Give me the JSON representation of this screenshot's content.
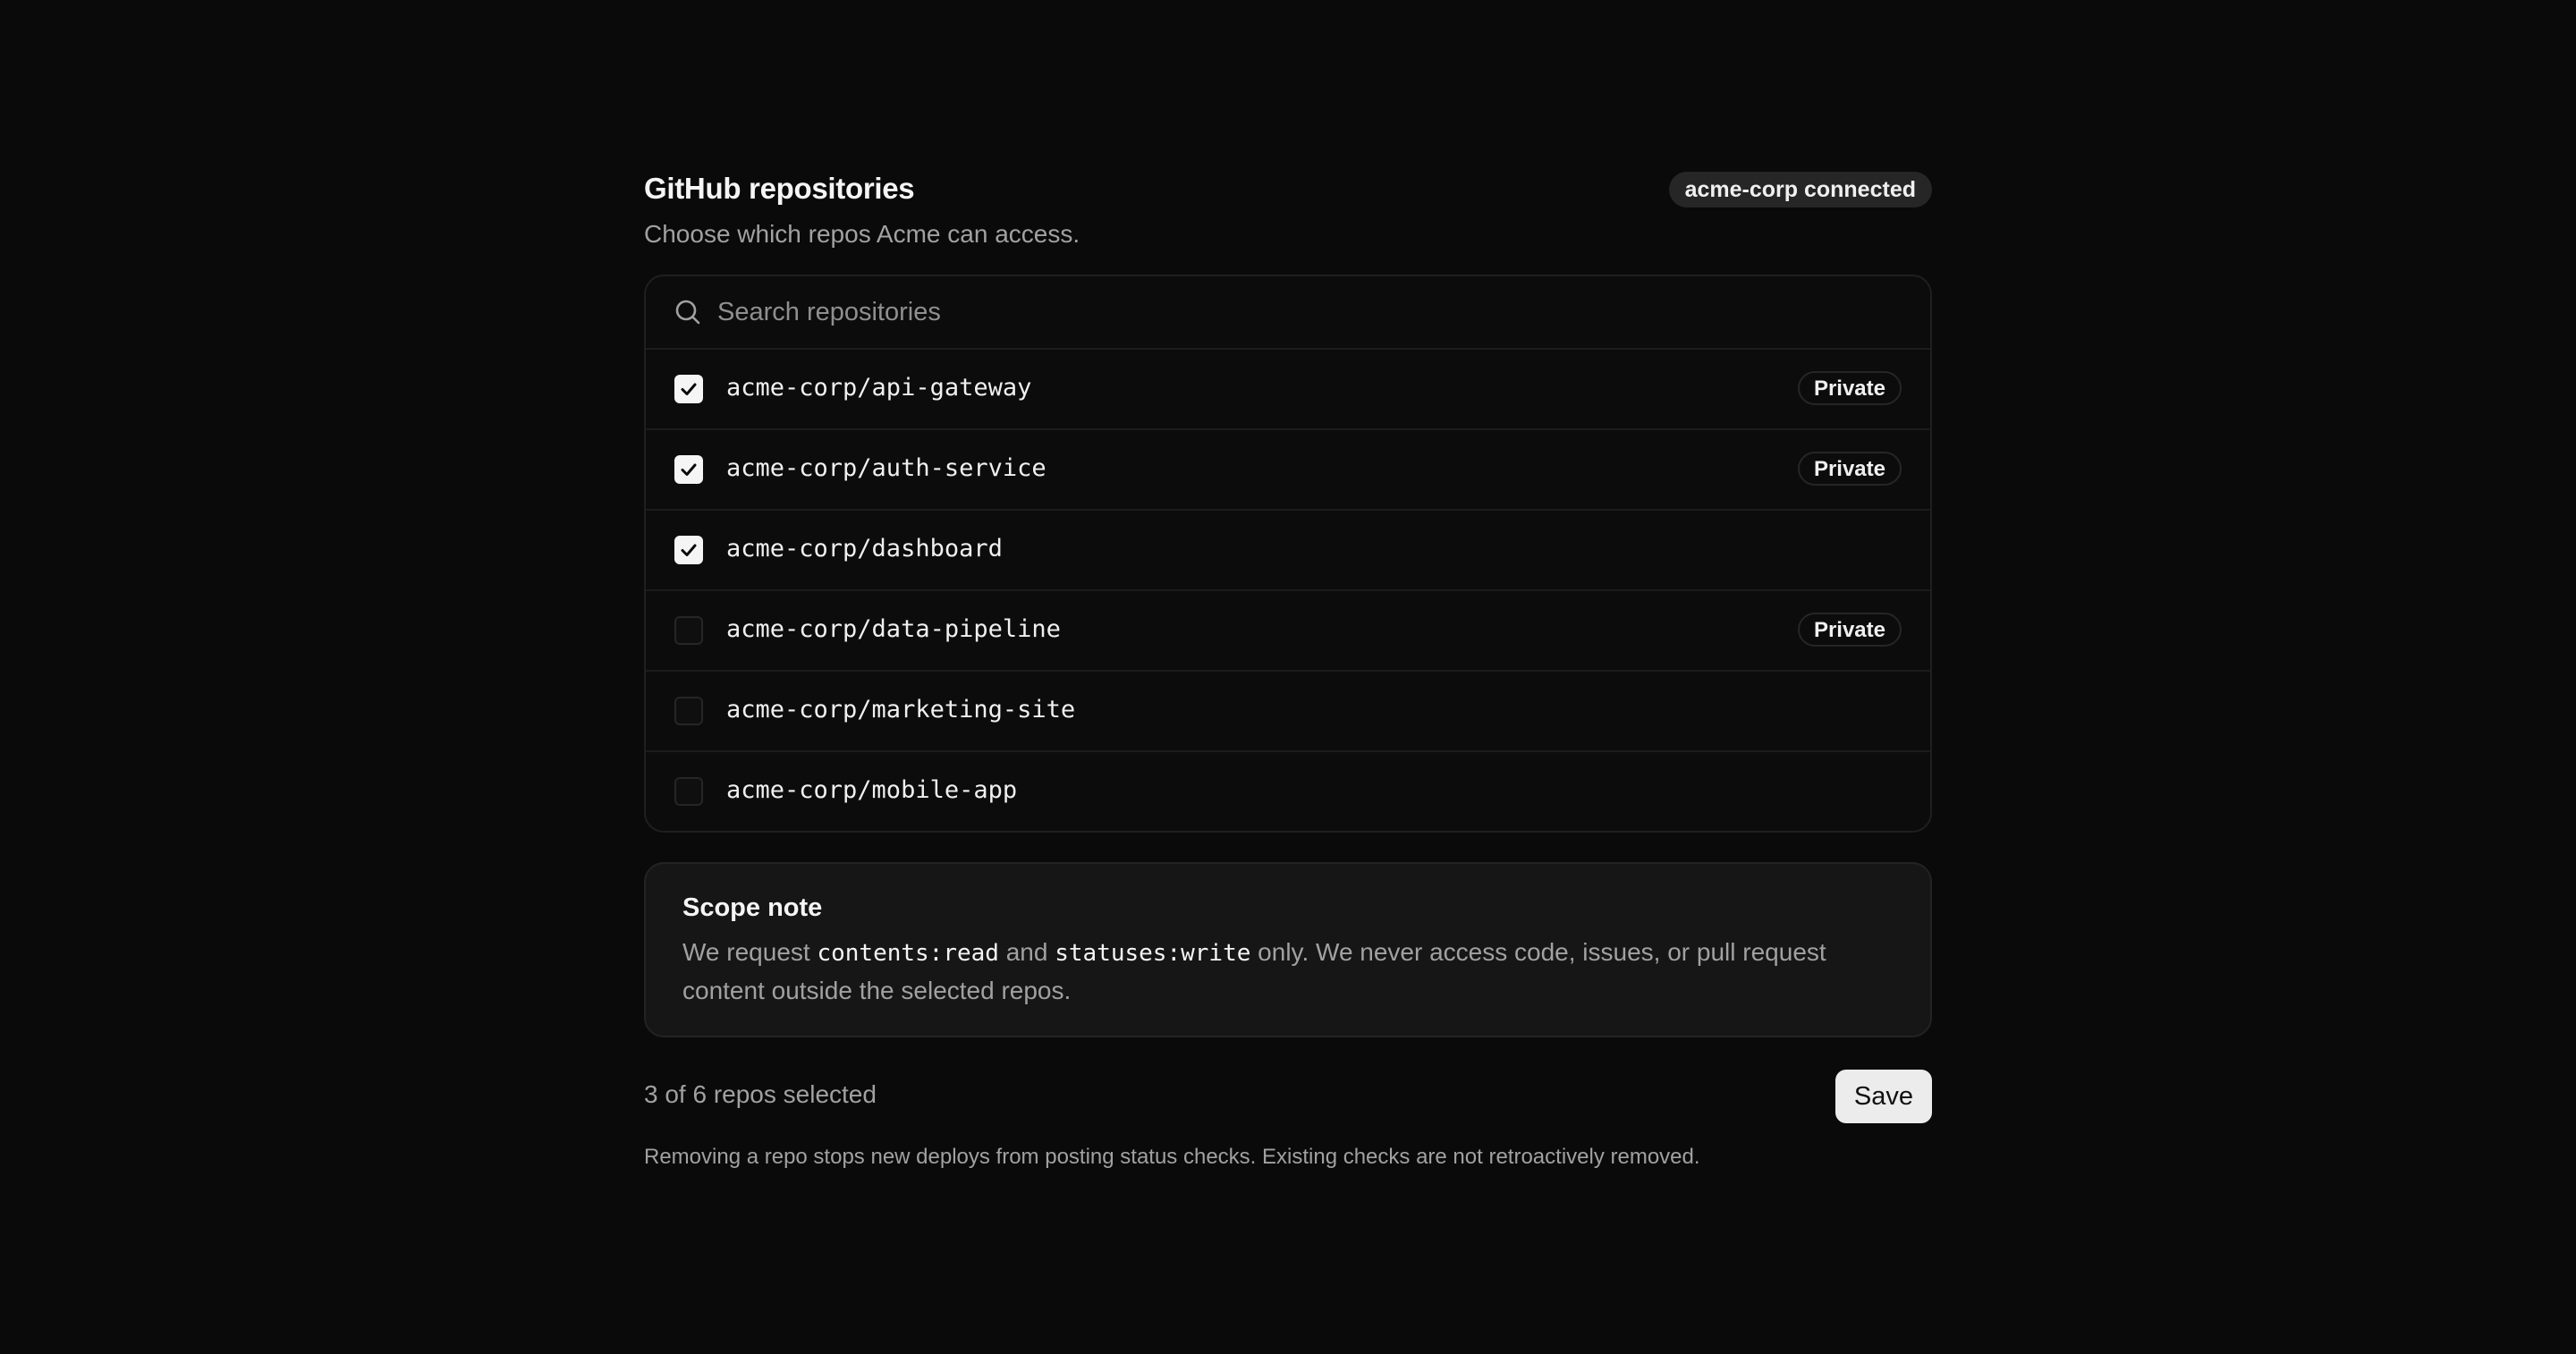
{
  "header": {
    "title": "GitHub repositories",
    "subtitle": "Choose which repos Acme can access.",
    "connected_badge": "acme-corp connected"
  },
  "search": {
    "placeholder": "Search repositories",
    "value": "",
    "icon": "search-icon"
  },
  "repos": [
    {
      "name": "acme-corp/api-gateway",
      "checked": true,
      "badge": "Private"
    },
    {
      "name": "acme-corp/auth-service",
      "checked": true,
      "badge": "Private"
    },
    {
      "name": "acme-corp/dashboard",
      "checked": true,
      "badge": ""
    },
    {
      "name": "acme-corp/data-pipeline",
      "checked": false,
      "badge": "Private"
    },
    {
      "name": "acme-corp/marketing-site",
      "checked": false,
      "badge": ""
    },
    {
      "name": "acme-corp/mobile-app",
      "checked": false,
      "badge": ""
    }
  ],
  "scope_note": {
    "title": "Scope note",
    "text_1": "We request ",
    "code_1": "contents:read",
    "text_2": " and ",
    "code_2": "statuses:write",
    "text_3": " only. We never access code, issues, or pull request content outside the selected repos."
  },
  "footer": {
    "selected_count": "3 of 6 repos selected",
    "save_label": "Save",
    "note": "Removing a repo stops new deploys from posting status checks. Existing checks are not retroactively removed."
  },
  "colors": {
    "background": "#0a0a0a",
    "text": "#ededed",
    "muted": "#a1a1a1",
    "checkbox_checked": "#f5f5f5",
    "save_button": "#ececec"
  }
}
